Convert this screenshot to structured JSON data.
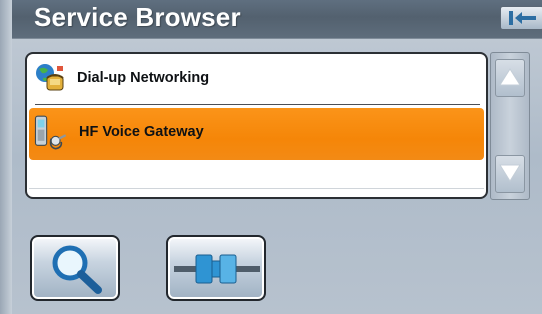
{
  "window": {
    "title": "Service Browser"
  },
  "toolbar": {
    "back_icon": "back-arrow-icon"
  },
  "services": [
    {
      "label": "Dial-up Networking",
      "icon": "dialup-networking-icon",
      "selected": false
    },
    {
      "label": "HF Voice Gateway",
      "icon": "hf-voice-gateway-icon",
      "selected": true
    }
  ],
  "scrollbar": {
    "up_icon": "arrow-up-icon",
    "down_icon": "arrow-down-icon"
  },
  "actions": {
    "search_icon": "magnifier-icon",
    "connect_icon": "connector-icon"
  },
  "colors": {
    "selection": "#f58608",
    "titlebar": "#56636f",
    "accent_blue": "#2a8fcf"
  }
}
